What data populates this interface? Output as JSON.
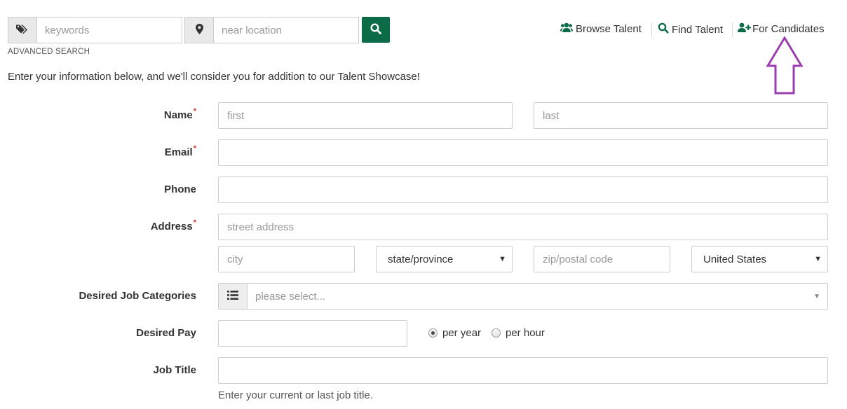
{
  "search": {
    "keywords_placeholder": "keywords",
    "location_placeholder": "near location",
    "advanced_search": "ADVANCED SEARCH"
  },
  "nav": {
    "browse_talent": "Browse Talent",
    "find_talent": "Find Talent",
    "for_candidates": "For Candidates"
  },
  "intro": "Enter your information below, and we'll consider you for addition to our Talent Showcase!",
  "form": {
    "name_label": "Name",
    "first_placeholder": "first",
    "last_placeholder": "last",
    "email_label": "Email",
    "phone_label": "Phone",
    "address_label": "Address",
    "street_placeholder": "street address",
    "city_placeholder": "city",
    "state_value": "state/province",
    "zip_placeholder": "zip/postal code",
    "country_value": "United States",
    "categories_label": "Desired Job Categories",
    "categories_placeholder": "please select...",
    "pay_label": "Desired Pay",
    "per_year": "per year",
    "per_hour": "per hour",
    "job_title_label": "Job Title",
    "job_title_help": "Enter your current or last job title.",
    "required_mark": "*"
  },
  "colors": {
    "brand_green": "#0b6b46",
    "annotation_arrow": "#9b3fb0",
    "required": "#c0392b"
  },
  "icons": [
    "tags-icon",
    "map-marker-icon",
    "search-icon",
    "users-icon",
    "search-icon",
    "user-plus-icon",
    "list-icon",
    "up-arrow-annotation"
  ]
}
